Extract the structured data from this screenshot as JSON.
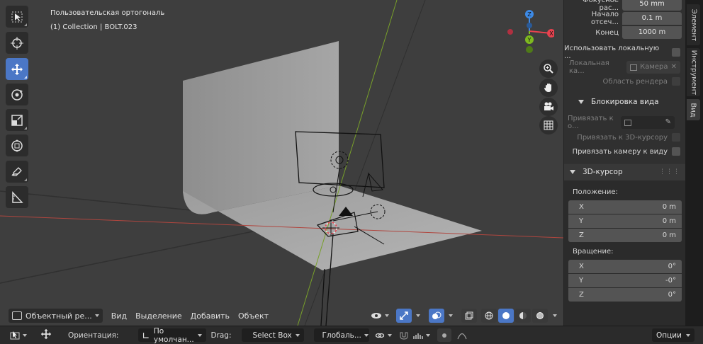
{
  "viewport": {
    "view_name": "Пользовательская ортогональ",
    "collection_info": "(1) Collection | BOLT.023",
    "header_menu": {
      "mode_label": "Объектный ре...",
      "view": "Вид",
      "select": "Выделение",
      "add": "Добавить",
      "object": "Объект"
    },
    "gizmo": {
      "x": "X",
      "y": "Y",
      "z": "Z"
    }
  },
  "toolbar": {
    "tools": [
      "select-box",
      "cursor",
      "move",
      "rotate",
      "scale",
      "transform",
      "annotate",
      "measure"
    ],
    "active_tool": "move"
  },
  "sidebar": {
    "focal_label": "Фокусное рас...",
    "focal_value": "50 mm",
    "clip_start_label": "Начало отсеч...",
    "clip_start_value": "0.1 m",
    "clip_end_label": "Конец",
    "clip_end_value": "1000 m",
    "use_local_camera": "Использовать локальную ...",
    "local_camera_label": "Локальная ка...",
    "local_camera_value": "Камера",
    "render_region": "Область рендера",
    "view_lock_header": "Блокировка вида",
    "lock_to_object_label": "Привязать к о...",
    "lock_to_3d_cursor": "Привязать к 3D-курсору",
    "lock_camera_to_view": "Привязать камеру к виду",
    "cursor_header": "3D-курсор",
    "location_label": "Положение:",
    "location": [
      {
        "axis": "X",
        "value": "0 m"
      },
      {
        "axis": "Y",
        "value": "0 m"
      },
      {
        "axis": "Z",
        "value": "0 m"
      }
    ],
    "rotation_label": "Вращение:",
    "rotation": [
      {
        "axis": "X",
        "value": "0°"
      },
      {
        "axis": "Y",
        "value": "-0°"
      },
      {
        "axis": "Z",
        "value": "0°"
      }
    ]
  },
  "tabs": {
    "item": "Элемент",
    "tool": "Инструмент",
    "view": "Вид"
  },
  "tool_header": {
    "orientation_label": "Ориентация:",
    "orientation_value": "По умолчан...",
    "drag_label": "Drag:",
    "drag_value": "Select Box",
    "pivot_value": "Глобаль...",
    "options": "Опции"
  },
  "colors": {
    "accent": "#4b77c6",
    "axis_x": "#e8424f",
    "axis_y": "#7fba20",
    "axis_z": "#3d8ae6"
  }
}
